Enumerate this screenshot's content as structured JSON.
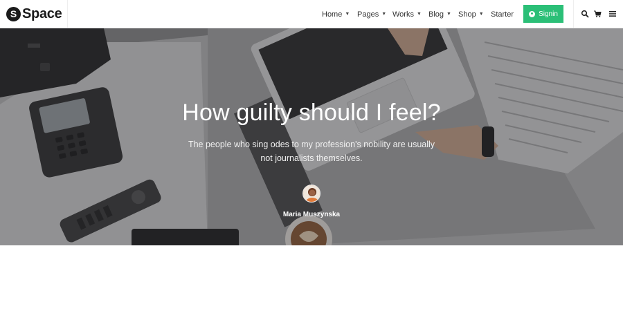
{
  "brand": {
    "mark": "S",
    "name": "Space"
  },
  "nav": {
    "items": [
      {
        "label": "Home",
        "has_dropdown": true
      },
      {
        "label": "Pages",
        "has_dropdown": true
      },
      {
        "label": "Works",
        "has_dropdown": true
      },
      {
        "label": "Blog",
        "has_dropdown": true
      },
      {
        "label": "Shop",
        "has_dropdown": true
      },
      {
        "label": "Starter",
        "has_dropdown": false
      }
    ],
    "signin_label": "Signin"
  },
  "tools": {
    "icons": [
      "search-icon",
      "cart-icon",
      "menu-icon"
    ]
  },
  "hero": {
    "title": "How guilty should I feel?",
    "subtitle": "The people who sing odes to my profession's nobility are usually not journalists themselves.",
    "author": "Maria Muszynska"
  },
  "colors": {
    "accent": "#2bbf77",
    "brand": "#1b1b1b"
  }
}
